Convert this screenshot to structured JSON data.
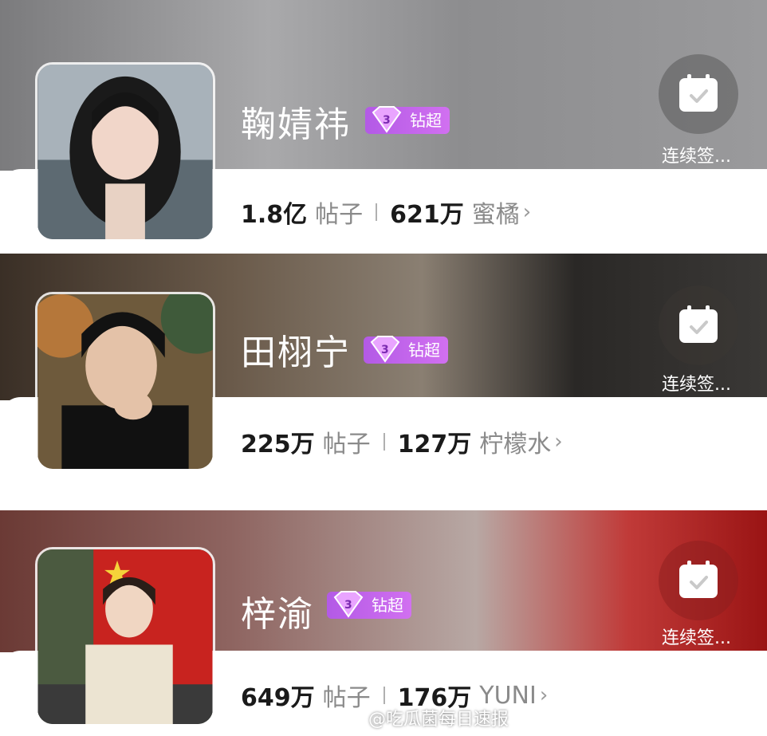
{
  "cards": [
    {
      "name": "鞠婧祎",
      "badge": "钻超",
      "posts_count": "1.8亿",
      "posts_label": "帖子",
      "fans_count": "621万",
      "fans_label": "蜜橘",
      "checkin_label": "连续签...",
      "avatar_icon": "avatar-photo"
    },
    {
      "name": "田栩宁",
      "badge": "钻超",
      "posts_count": "225万",
      "posts_label": "帖子",
      "fans_count": "127万",
      "fans_label": "柠檬水",
      "checkin_label": "连续签...",
      "avatar_icon": "avatar-photo"
    },
    {
      "name": "梓渝",
      "badge": "钻超",
      "posts_count": "649万",
      "posts_label": "帖子",
      "fans_count": "176万",
      "fans_label": "YUNI",
      "checkin_label": "连续签...",
      "avatar_icon": "avatar-photo"
    }
  ],
  "chevron": "›",
  "watermark": "@吃瓜菌每日速报",
  "colors": {
    "badge_purple": "#c266ec",
    "stat_label_gray": "#8a8a8a",
    "card3_accent_red": "#c03a38"
  }
}
